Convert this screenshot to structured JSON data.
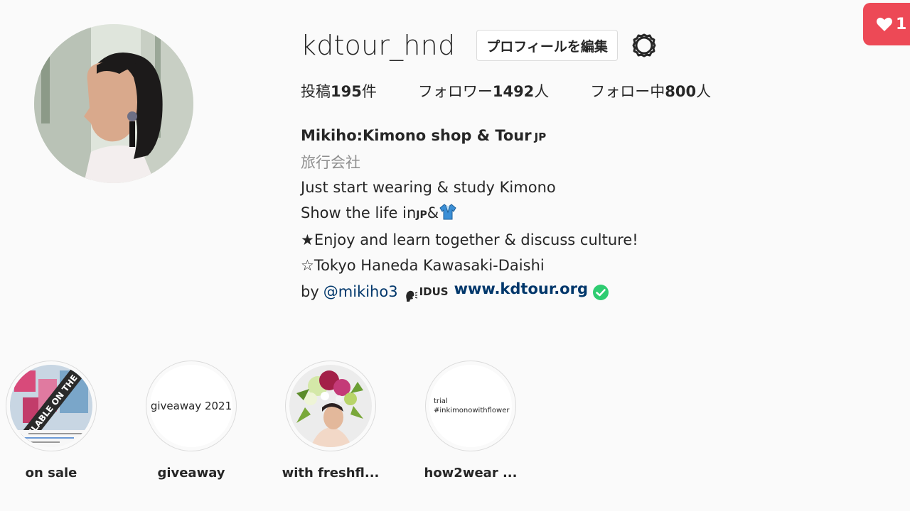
{
  "profile": {
    "username": "kdtour_hnd",
    "edit_button_label": "プロフィールを編集",
    "settings_icon": "gear-icon",
    "stats": [
      {
        "label_prefix": "投稿",
        "count": "195",
        "label_suffix": "件"
      },
      {
        "label_prefix": "フォロワー",
        "count": "1492",
        "label_suffix": "人"
      },
      {
        "label_prefix": "フォロー中",
        "count": "800",
        "label_suffix": "人"
      }
    ]
  },
  "bio": {
    "name": "Mikiho:Kimono shop & Tour",
    "name_flag": "JP",
    "category": "旅行会社",
    "line1": "Just start wearing & study Kimono",
    "line2_text": "Show the life in",
    "line2_flag": "JP",
    "line2_amp": "&",
    "line3": "★Enjoy and learn together & discuss culture!",
    "line4": "☆Tokyo Haneda Kawasaki-Daishi",
    "by_text": "by",
    "mention": "@mikiho3",
    "ids_tag": "IDUS",
    "website": "www.kdtour.org"
  },
  "highlights": [
    {
      "label": "on sale",
      "cover_type": "image",
      "cover_text": "AVAILABLE ON THE SH"
    },
    {
      "label": "giveaway",
      "cover_type": "text",
      "cover_text": "giveaway 2021"
    },
    {
      "label": "with freshfl...",
      "cover_type": "image",
      "cover_text": ""
    },
    {
      "label": "how2wear ...",
      "cover_type": "text",
      "cover_text": "trial",
      "cover_text2": "#inkimonowithflower"
    }
  ],
  "notification": {
    "icon": "heart-icon",
    "count": "1"
  },
  "colors": {
    "background": "#fafafa",
    "link": "#00376b",
    "muted": "#8e8e8e",
    "notification": "#ed4956",
    "verified": "#2ecc71"
  }
}
